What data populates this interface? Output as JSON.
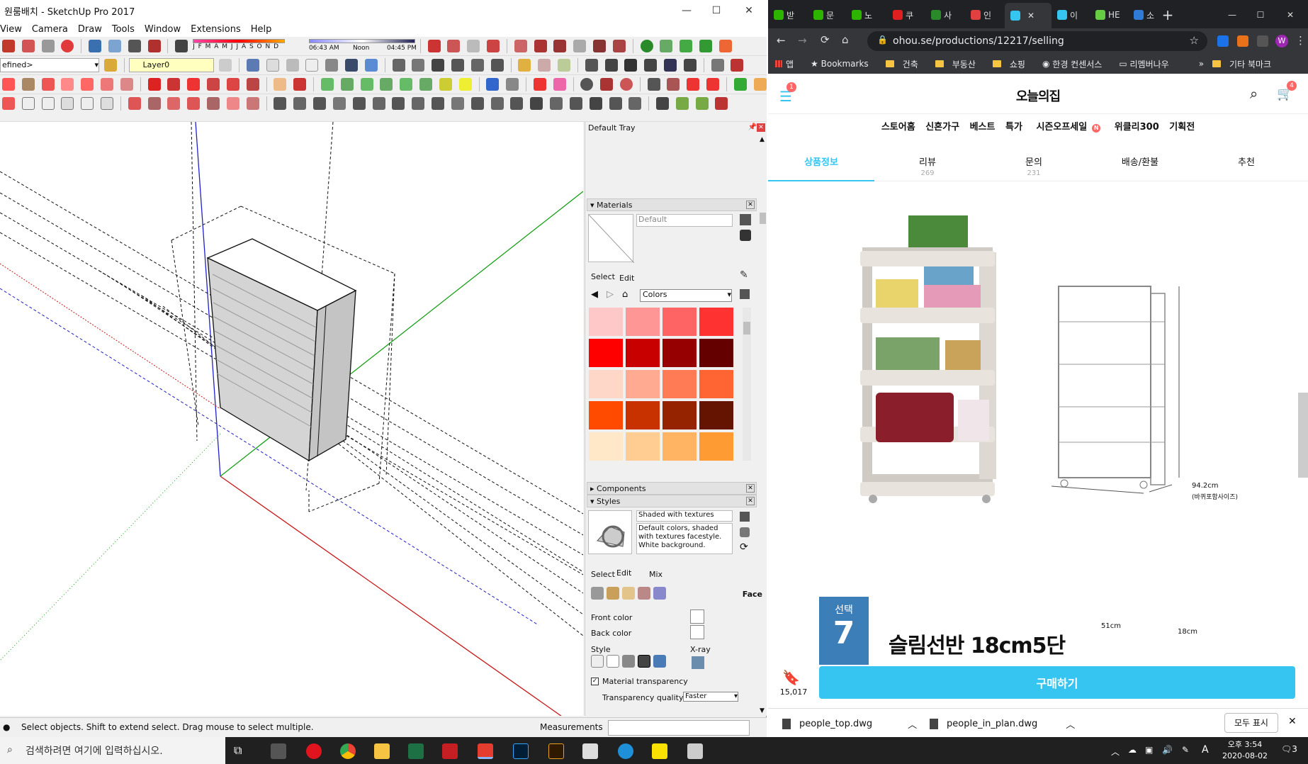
{
  "sketchup": {
    "title": "원룸배치 - SketchUp Pro 2017",
    "menu": [
      "View",
      "Camera",
      "Draw",
      "Tools",
      "Window",
      "Extensions",
      "Help"
    ],
    "months": "J F M A M J J A S O N D",
    "time_start": "06:43 AM",
    "time_noon": "Noon",
    "time_end": "04:45 PM",
    "style_dropdown": "efined>",
    "layer": "Layer0",
    "status": "Select objects. Shift to extend select. Drag mouse to select multiple.",
    "measurements_label": "Measurements",
    "tray": {
      "title": "Default Tray",
      "materials_title": "Materials",
      "material_name": "Default",
      "select_tab": "Select",
      "edit_tab": "Edit",
      "collection": "Colors",
      "components_title": "Components",
      "styles_title": "Styles",
      "style_name": "Shaded with textures",
      "style_desc": "Default colors, shaded with textures facestyle. White background.",
      "styles_tabs": [
        "Select",
        "Edit",
        "Mix"
      ],
      "face_label": "Face",
      "front_color": "Front color",
      "back_color": "Back color",
      "style_label": "Style",
      "xray_label": "X-ray",
      "material_transparency": "Material transparency",
      "transparency_quality": "Transparency quality:",
      "transparency_value": "Faster"
    },
    "swatches": [
      "#ffc8c8",
      "#ff9696",
      "#ff6464",
      "#ff3232",
      "#ff0000",
      "#c80000",
      "#960000",
      "#640000",
      "#ffd7c8",
      "#ffaa91",
      "#ff7b55",
      "#ff6432",
      "#ff4b00",
      "#c83200",
      "#962300",
      "#641400",
      "#ffe8c8",
      "#ffcd91",
      "#ffb464",
      "#ff9b32"
    ]
  },
  "chrome": {
    "tabs": [
      "받",
      "문",
      "노",
      "쿠",
      "사",
      "인",
      "이",
      "HE",
      "소"
    ],
    "url": "ohou.se/productions/12217/selling",
    "bookmarks": [
      "앱",
      "Bookmarks",
      "건축",
      "부동산",
      "쇼핑",
      "한경 컨센서스",
      "리멤버나우"
    ],
    "other_bookmarks": "기타 북마크",
    "more": "»",
    "site_logo": "오늘의집",
    "menu_badge": "1",
    "cart_badge": "4",
    "categories": [
      "스토어홈",
      "신혼가구",
      "베스트",
      "특가",
      "시즌오프세일",
      "위클리300",
      "기획전"
    ],
    "season_badge": "N",
    "product_tabs": [
      {
        "label": "상품정보",
        "count": ""
      },
      {
        "label": "리뷰",
        "count": "269"
      },
      {
        "label": "문의",
        "count": "231"
      },
      {
        "label": "배송/환불",
        "count": ""
      },
      {
        "label": "추천",
        "count": ""
      }
    ],
    "dim_height": "94.2cm",
    "dim_height_note": "(바퀴포함사이즈)",
    "dim_width": "51cm",
    "dim_depth": "18cm",
    "select_label": "선택",
    "select_number": "7",
    "product_name": "슬림선반 18cm5단",
    "bookmark_count": "15,017",
    "buy_button": "구매하기",
    "downloads": [
      "people_top.dwg",
      "people_in_plan.dwg"
    ],
    "show_all": "모두 표시"
  },
  "taskbar": {
    "search_placeholder": "검색하려면 여기에 입력하십시오.",
    "ime": "A",
    "time": "오후 3:54",
    "date": "2020-08-02",
    "notif_count": "3"
  }
}
